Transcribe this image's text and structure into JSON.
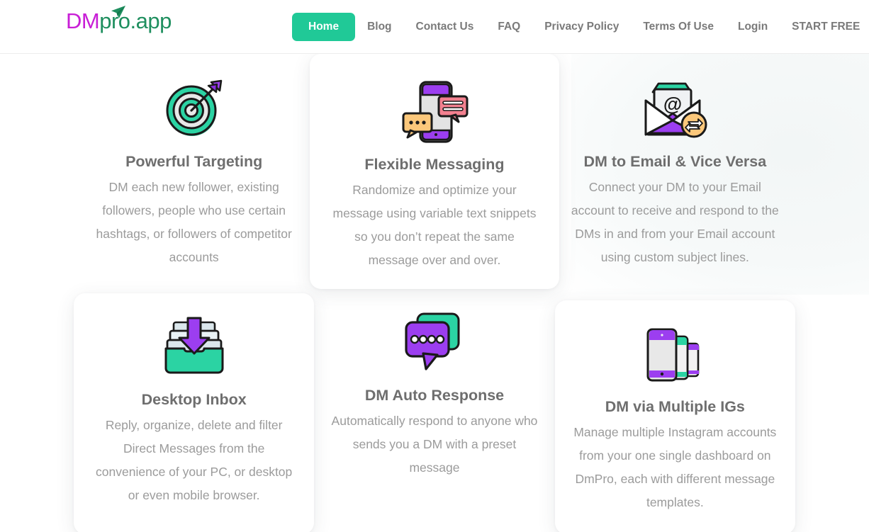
{
  "brand": {
    "name_part1": "DM",
    "name_part2": "pro.app",
    "color_purple": "#c81ed6",
    "color_green": "#1f8f5f",
    "plane_icon": "paper-plane-icon"
  },
  "nav": {
    "accent_color": "#20c997",
    "items": [
      {
        "label": "Home",
        "active": true
      },
      {
        "label": "Blog",
        "active": false
      },
      {
        "label": "Contact Us",
        "active": false
      },
      {
        "label": "FAQ",
        "active": false
      },
      {
        "label": "Privacy Policy",
        "active": false
      },
      {
        "label": "Terms Of Use",
        "active": false
      },
      {
        "label": "Login",
        "active": false
      },
      {
        "label": "START FREE",
        "active": false
      }
    ]
  },
  "features": [
    {
      "icon": "target-dartboard-icon",
      "title": "Powerful Targeting",
      "description": "DM each new follower, existing followers, people who use certain hashtags, or followers of competitor accounts"
    },
    {
      "icon": "phone-chat-bubbles-icon",
      "title": "Flexible Messaging",
      "description": "Randomize and optimize your message using variable text snippets so you don’t repeat the same message over and over."
    },
    {
      "icon": "email-envelope-sync-icon",
      "title": "DM to Email & Vice Versa",
      "description": "Connect your DM to your Email account to receive and respond to the DMs in and from your Email account using custom subject lines."
    },
    {
      "icon": "inbox-tray-download-icon",
      "title": "Desktop Inbox",
      "description": "Reply, organize, delete and filter Direct Messages from the convenience of your PC, or desktop or even mobile browser."
    },
    {
      "icon": "chat-bubbles-dots-icon",
      "title": "DM Auto Response",
      "description": "Automatically respond to anyone who sends you a DM with a preset message"
    },
    {
      "icon": "multiple-devices-icon",
      "title": "DM via Multiple IGs",
      "description": "Manage multiple Instagram accounts from your one single dashboard on DmPro, each with different message templates."
    }
  ],
  "palette": {
    "teal": "#20c997",
    "purple": "#9c3ef0",
    "pink": "#f2808f",
    "orange": "#fcc87b",
    "dark": "#1a1a1a",
    "light_gray": "#e3e3e3"
  }
}
